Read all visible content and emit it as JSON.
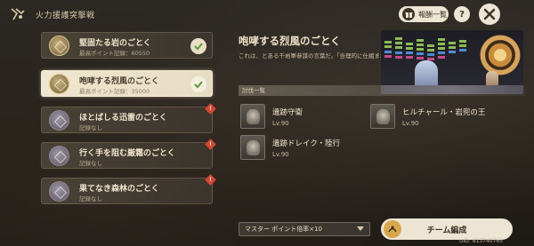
{
  "event": {
    "title": "火力援護突撃戦",
    "icon": "event-flag-icon"
  },
  "header": {
    "report_label": "報酬一覧",
    "report_icon": "gift-icon",
    "help_label": "?",
    "close_icon": "close-icon"
  },
  "stages": [
    {
      "name": "堅固たる岩のごとく",
      "sub": "最高ポイント記録：60550",
      "state": "completed"
    },
    {
      "name": "咆哮する烈風のごとく",
      "sub": "最高ポイント記録：35000",
      "state": "completed-selected"
    },
    {
      "name": "ほとばしる迅雷のごとく",
      "sub": "記録なし",
      "state": "new"
    },
    {
      "name": "行く手を阻む厳霜のごとく",
      "sub": "記録なし",
      "state": "new"
    },
    {
      "name": "果てなき森林のごとく",
      "sub": "記録なし",
      "state": "new"
    }
  ],
  "detail": {
    "title": "咆哮する烈風のごとく",
    "description": "これは、とある千岩軍参謀の言葉だ。「合理的に仕組まれた攻撃は、烈風のごとく、敵の防衛線のあらゆる弱点を突き、陣形の後方へ回り込む…」"
  },
  "enemies": {
    "heading": "討伐一覧",
    "items": [
      {
        "name": "遺跡守衛",
        "level": "Lv.90"
      },
      {
        "name": "ヒルチャール・岩兜の王",
        "level": "Lv.90"
      },
      {
        "name": "遺跡ドレイク・陸行",
        "level": "Lv.90"
      }
    ]
  },
  "footer": {
    "multiplier_label": "マスター ポイント倍率×10",
    "team_button_label": "チーム編成",
    "uid": "UID: 813740765"
  },
  "colors": {
    "accent_cream": "#ece5d3",
    "check_green": "#5c9a3c",
    "alert_red": "#d8452e"
  }
}
